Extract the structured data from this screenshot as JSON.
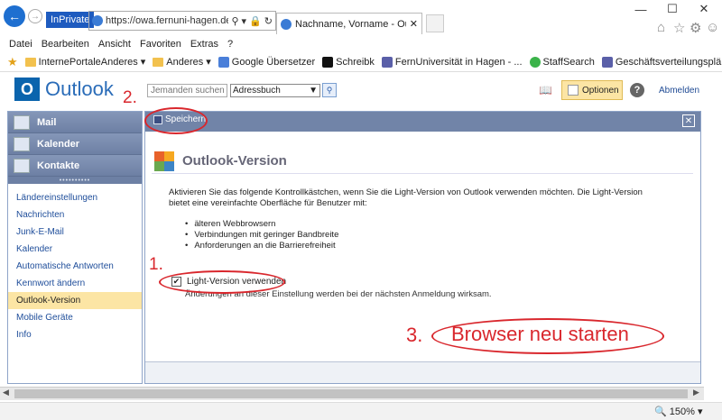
{
  "browser": {
    "inprivate_label": "InPrivate",
    "url": "https://owa.fernuni-hagen.de/c",
    "tab_title": "Nachname, Vorname - Outlo...",
    "menu": [
      "Datei",
      "Bearbeiten",
      "Ansicht",
      "Favoriten",
      "Extras",
      "?"
    ],
    "favorites": [
      {
        "label": "InternePortaleAnderes",
        "type": "folder"
      },
      {
        "label": "Anderes",
        "type": "folder"
      },
      {
        "label": "Google Übersetzer",
        "type": "link"
      },
      {
        "label": "Schreibk",
        "type": "link"
      },
      {
        "label": "FernUniversität in Hagen - ...",
        "type": "link"
      },
      {
        "label": "StaffSearch",
        "type": "link"
      },
      {
        "label": "Geschäftsverteilungspläne (...",
        "type": "link"
      }
    ],
    "zoom": "150%"
  },
  "owa": {
    "logo": "Outlook",
    "search_placeholder": "Jemanden suchen",
    "addressbook": "Adressbuch",
    "options_label": "Optionen",
    "signout_label": "Abmelden",
    "nav_sections": [
      "Mail",
      "Kalender",
      "Kontakte"
    ],
    "nav_items": [
      "Ländereinstellungen",
      "Nachrichten",
      "Junk-E-Mail",
      "Kalender",
      "Automatische Antworten",
      "Kennwort ändern",
      "Outlook-Version",
      "Mobile Geräte",
      "Info"
    ],
    "selected_nav": "Outlook-Version",
    "save_label": "Speichern",
    "page_title": "Outlook-Version",
    "description": "Aktivieren Sie das folgende Kontrollkästchen, wenn Sie die Light-Version von Outlook verwenden möchten. Die Light-Version bietet eine vereinfachte Oberfläche für Benutzer mit:",
    "bullets": [
      "älteren Webbrowsern",
      "Verbindungen mit geringer Bandbreite",
      "Anforderungen an die Barrierefreiheit"
    ],
    "checkbox_label": "Light-Version verwenden",
    "checkbox_checked": true,
    "checkbox_note": "Änderungen an dieser Einstellung werden bei der nächsten Anmeldung wirksam."
  },
  "annotations": {
    "step1": "1.",
    "step2": "2.",
    "step3": "3.",
    "restart_text": "Browser neu starten",
    "color": "#d9272d"
  }
}
